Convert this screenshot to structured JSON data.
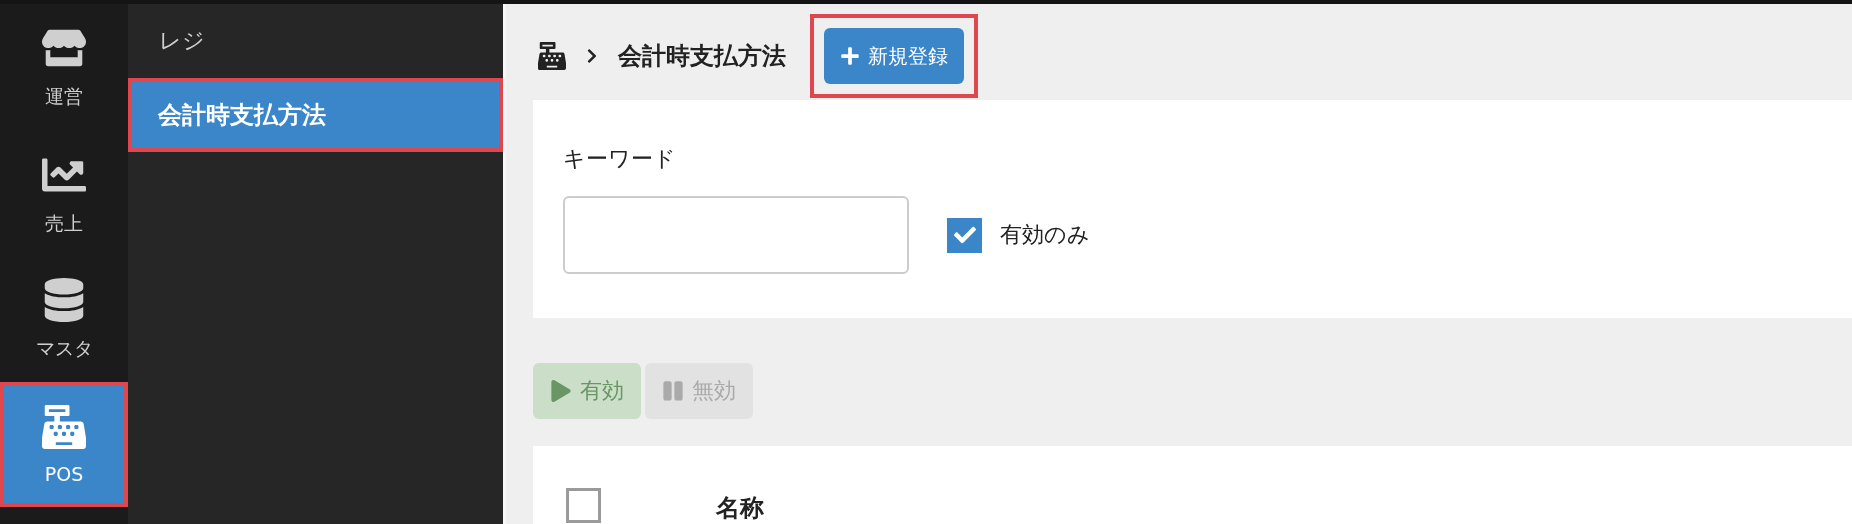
{
  "nav_rail": {
    "items": [
      {
        "label": "運営",
        "kind": "store",
        "selected": false,
        "highlighted": false
      },
      {
        "label": "売上",
        "kind": "chart",
        "selected": false,
        "highlighted": false
      },
      {
        "label": "マスタ",
        "kind": "database",
        "selected": false,
        "highlighted": false
      },
      {
        "label": "POS",
        "kind": "register",
        "selected": true,
        "highlighted": true
      }
    ]
  },
  "submenu": {
    "heading": "レジ",
    "items": [
      {
        "label": "会計時支払方法",
        "selected": true,
        "highlighted": true
      }
    ]
  },
  "header": {
    "breadcrumb_current": "会計時支払方法",
    "new_button": {
      "label": "新規登録",
      "highlighted": true
    }
  },
  "filters": {
    "keyword": {
      "label": "キーワード"
    },
    "active_only": {
      "label": "有効のみ",
      "checked": true
    }
  },
  "actions": [
    {
      "label": "有効",
      "kind": "enable",
      "disabled": true
    },
    {
      "label": "無効",
      "kind": "disable",
      "disabled": true
    }
  ],
  "table": {
    "select_all_checked": false,
    "columns": [
      "名称"
    ]
  }
}
